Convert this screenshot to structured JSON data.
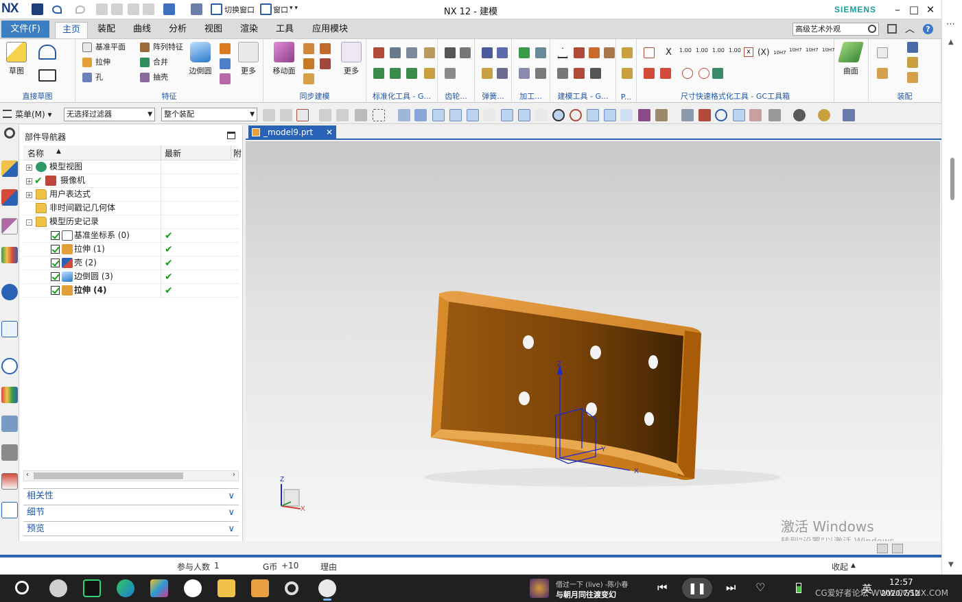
{
  "titlebar": {
    "logo": "NX",
    "title": "NX 12 - 建模",
    "vendor": "SIEMENS",
    "quick_access": [
      "保存",
      "撤消",
      "重做",
      "剪切",
      "复制",
      "粘贴",
      "重复命令",
      "触控模式",
      "切换窗口",
      "窗口"
    ],
    "switch_window_label": "切换窗口",
    "window_label": "窗口"
  },
  "ribbon": {
    "file_tab": "文件(F)",
    "tabs": [
      "主页",
      "装配",
      "曲线",
      "分析",
      "视图",
      "渲染",
      "工具",
      "应用模块"
    ],
    "active_tab": "主页",
    "search_value": "高级艺术外观",
    "groups": {
      "direct_sketch": {
        "label": "直接草图",
        "sketch": "草图"
      },
      "feature": {
        "label": "特征",
        "datum_plane": "基准平面",
        "pattern_feature": "阵列特征",
        "extrude": "拉伸",
        "unite": "合并",
        "hole": "孔",
        "shell": "抽壳",
        "edge_blend": "边倒圆",
        "more": "更多"
      },
      "sync_modeling": {
        "label": "同步建模",
        "move_face": "移动面",
        "more": "更多"
      },
      "standard_tools": {
        "label": "标准化工具 - G..."
      },
      "gear": {
        "label": "齿轮..."
      },
      "spring": {
        "label": "弹簧..."
      },
      "machining": {
        "label": "加工..."
      },
      "modeling_tools": {
        "label": "建模工具 - G..."
      },
      "p": {
        "label": "P..."
      },
      "dimension_format": {
        "label": "尺寸快速格式化工具 - GC工具箱",
        "x1": "X",
        "x2": "(X)",
        "tol1": "10H7",
        "tol2": "10H7",
        "tol3": "10H7",
        "tol4": "10H7",
        "dims": [
          "1.00",
          "1.00",
          "1.00",
          "1.00"
        ]
      },
      "surface": {
        "label": "曲面",
        "surface": "曲面"
      },
      "assembly": {
        "label": "装配"
      }
    }
  },
  "selection_bar": {
    "menu": "菜单(M)",
    "filter": "无选择过滤器",
    "scope": "整个装配"
  },
  "navigator": {
    "title": "部件导航器",
    "columns": {
      "name": "名称",
      "latest": "最新",
      "extra": "附"
    },
    "rows": [
      {
        "label": "模型视图",
        "depth": 0,
        "expand": "+",
        "latest": ""
      },
      {
        "label": "摄像机",
        "depth": 0,
        "expand": "+",
        "latest": ""
      },
      {
        "label": "用户表达式",
        "depth": 0,
        "expand": "+",
        "latest": ""
      },
      {
        "label": "非时间戳记几何体",
        "depth": 0,
        "expand": "",
        "latest": ""
      },
      {
        "label": "模型历史记录",
        "depth": 0,
        "expand": "-",
        "latest": ""
      },
      {
        "label": "基准坐标系 (0)",
        "depth": 1,
        "expand": "",
        "latest": "✔"
      },
      {
        "label": "拉伸 (1)",
        "depth": 1,
        "expand": "",
        "latest": "✔"
      },
      {
        "label": "壳 (2)",
        "depth": 1,
        "expand": "",
        "latest": "✔"
      },
      {
        "label": "边倒圆 (3)",
        "depth": 1,
        "expand": "",
        "latest": "✔"
      },
      {
        "label": "拉伸 (4)",
        "depth": 1,
        "expand": "",
        "latest": "✔"
      }
    ],
    "panels": [
      "相关性",
      "细节",
      "预览"
    ]
  },
  "document": {
    "tab": "_model9.prt",
    "close": "✕",
    "triad_z": "Z",
    "triad_x": "X",
    "datum_z": "Z",
    "datum_y": "Y",
    "datum_x": "X"
  },
  "watermark": {
    "line1": "激活 Windows",
    "line2": "转到\"设置\"以激活 Windows。"
  },
  "page_strip": {
    "participants_label": "参与人数",
    "participants_value": "1",
    "coin_label": "G币",
    "coin_value": "+10",
    "reason_label": "理由",
    "collapse": "收起"
  },
  "taskbar": {
    "media_line1": "借过一下 (live) -陈小春",
    "media_line2": "与朝月同往渡变幻",
    "ime": "英",
    "time": "12:57",
    "date": "2020/7/12",
    "forum": "CG爱好者论坛 WWW.CGSNX.COM"
  },
  "colors": {
    "accent": "#2a63b6",
    "file_tab": "#3a7fc4",
    "part": "#c87a10",
    "siemens": "#1a9d9d"
  }
}
